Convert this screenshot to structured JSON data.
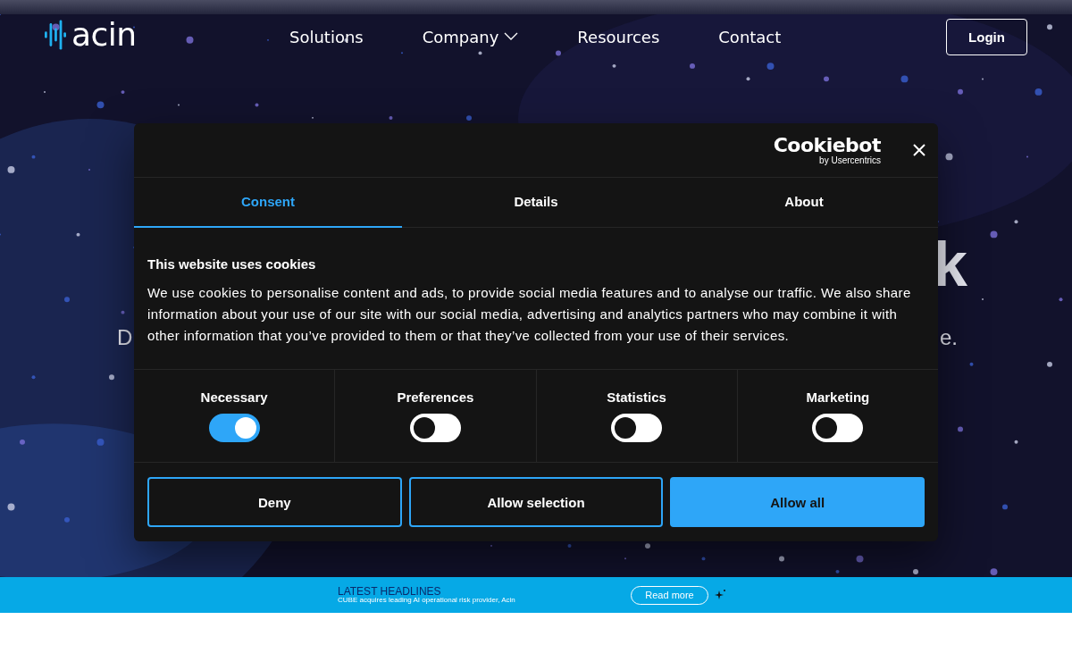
{
  "nav": {
    "logo": "acin",
    "links": [
      {
        "label": "Solutions",
        "dropdown": false
      },
      {
        "label": "Company",
        "dropdown": true
      },
      {
        "label": "Resources",
        "dropdown": false
      },
      {
        "label": "Contact",
        "dropdown": false
      }
    ],
    "login": "Login"
  },
  "hero": {
    "title_end": "k",
    "subtitle_start": "D",
    "subtitle_end": "e."
  },
  "dialog": {
    "brand": "Cookiebot",
    "brand_sub": "by Usercentrics",
    "tabs": [
      {
        "label": "Consent",
        "selected": true
      },
      {
        "label": "Details",
        "selected": false
      },
      {
        "label": "About",
        "selected": false
      }
    ],
    "heading": "This website uses cookies",
    "text": "We use cookies to personalise content and ads, to provide social media features and to analyse our traffic. We also share information about your use of our site with our social media, advertising and analytics partners who may combine it with other information that you’ve provided to them or that they’ve collected from your use of their services.",
    "toggles": [
      {
        "label": "Necessary",
        "on": true
      },
      {
        "label": "Preferences",
        "on": false
      },
      {
        "label": "Statistics",
        "on": false
      },
      {
        "label": "Marketing",
        "on": false
      }
    ],
    "buttons": [
      {
        "label": "Deny",
        "kind": "outline"
      },
      {
        "label": "Allow selection",
        "kind": "outline"
      },
      {
        "label": "Allow all",
        "kind": "primary"
      }
    ]
  },
  "banner": {
    "title": "LATEST HEADLINES",
    "text": "CUBE acquires leading AI operational risk provider, Acin",
    "button": "Read more"
  }
}
